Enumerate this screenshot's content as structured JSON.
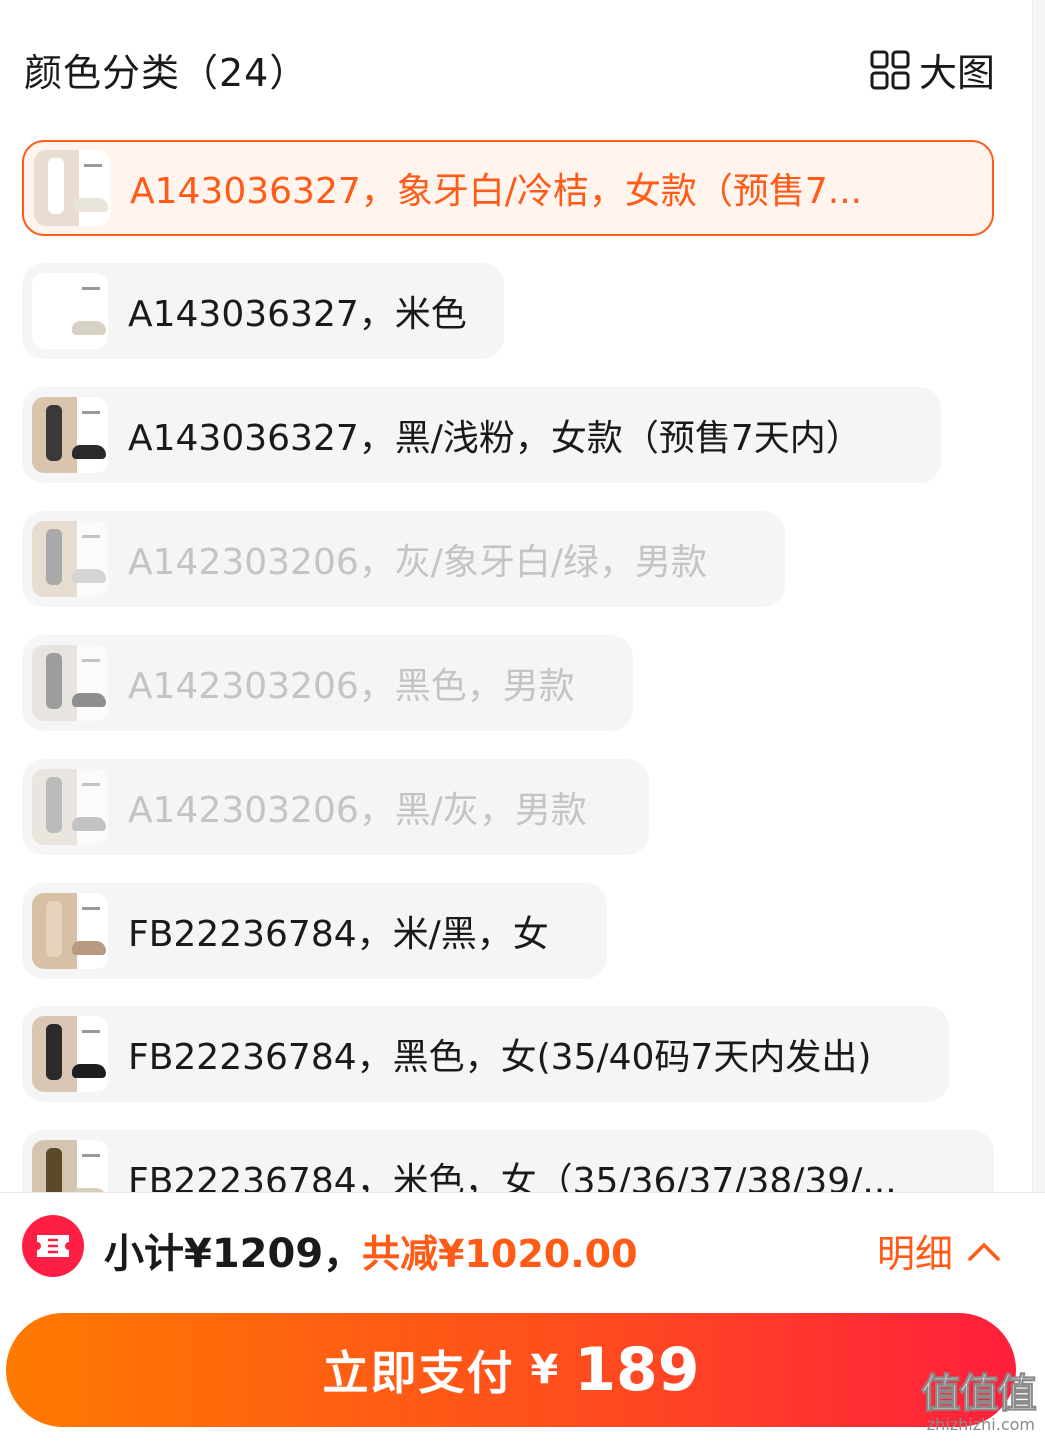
{
  "header": {
    "title": "颜色分类（24）",
    "view_toggle_label": "大图",
    "view_toggle_icon": "grid-icon"
  },
  "colors": {
    "accent": "#ff5a16",
    "selected_bg": "#fff4ee",
    "item_bg": "#f5f5f5",
    "disabled_text": "#c4c4c4",
    "pay_gradient_start": "#ff7a00",
    "pay_gradient_end": "#ff1f3d",
    "coupon_badge": "#ff1f44"
  },
  "variants": [
    {
      "label": "A143036327，象牙白/冷桔，女款（预售7...",
      "state": "selected",
      "thumb": {
        "left": "#e8ddd0",
        "shoe": "#e9e4dc",
        "person": "#ffffff"
      }
    },
    {
      "label": "A143036327，米色",
      "state": "normal",
      "thumb": {
        "left": "#ffffff",
        "shoe": "#d8d2c6",
        "person": "#ffffff"
      }
    },
    {
      "label": "A143036327，黑/浅粉，女款（预售7天内）",
      "state": "normal",
      "thumb": {
        "left": "#d9c4ad",
        "shoe": "#2a2a2a",
        "person": "#3a3a3a"
      }
    },
    {
      "label": "A142303206，灰/象牙白/绿，男款",
      "state": "disabled",
      "thumb": {
        "left": "#d9c6b1",
        "shoe": "#b9b9b9",
        "person": "#6a6a6a"
      }
    },
    {
      "label": "A142303206，黑色，男款",
      "state": "disabled",
      "thumb": {
        "left": "#ddd6cc",
        "shoe": "#3a3a3a",
        "person": "#555555"
      }
    },
    {
      "label": "A142303206，黑/灰，男款",
      "state": "disabled",
      "thumb": {
        "left": "#e0d8cd",
        "shoe": "#9a9a9a",
        "person": "#8a8a8a"
      }
    },
    {
      "label": "FB22236784，米/黑，女",
      "state": "normal",
      "thumb": {
        "left": "#d7c0a6",
        "shoe": "#b89a83",
        "person": "#e5d1bc"
      }
    },
    {
      "label": "FB22236784，黑色，女(35/40码7天内发出)",
      "state": "normal",
      "thumb": {
        "left": "#d9c7b4",
        "shoe": "#1e1e1e",
        "person": "#2b2b2b"
      }
    },
    {
      "label": "FB22236784，米色，女（35/36/37/38/39/...",
      "state": "normal",
      "thumb": {
        "left": "#d4c5b0",
        "shoe": "#d8cdb8",
        "person": "#5b4a2a"
      }
    }
  ],
  "footer": {
    "coupon_icon": "ticket-icon",
    "subtotal": "小计¥1209，",
    "discount": "共减¥1020.00",
    "detail_label": "明细",
    "detail_icon": "chevron-up-icon",
    "pay_label": "立即支付",
    "pay_currency": "¥",
    "pay_amount": "189"
  },
  "watermark": {
    "glyphs": "值值值",
    "domain": "zhizhizhi.com"
  }
}
